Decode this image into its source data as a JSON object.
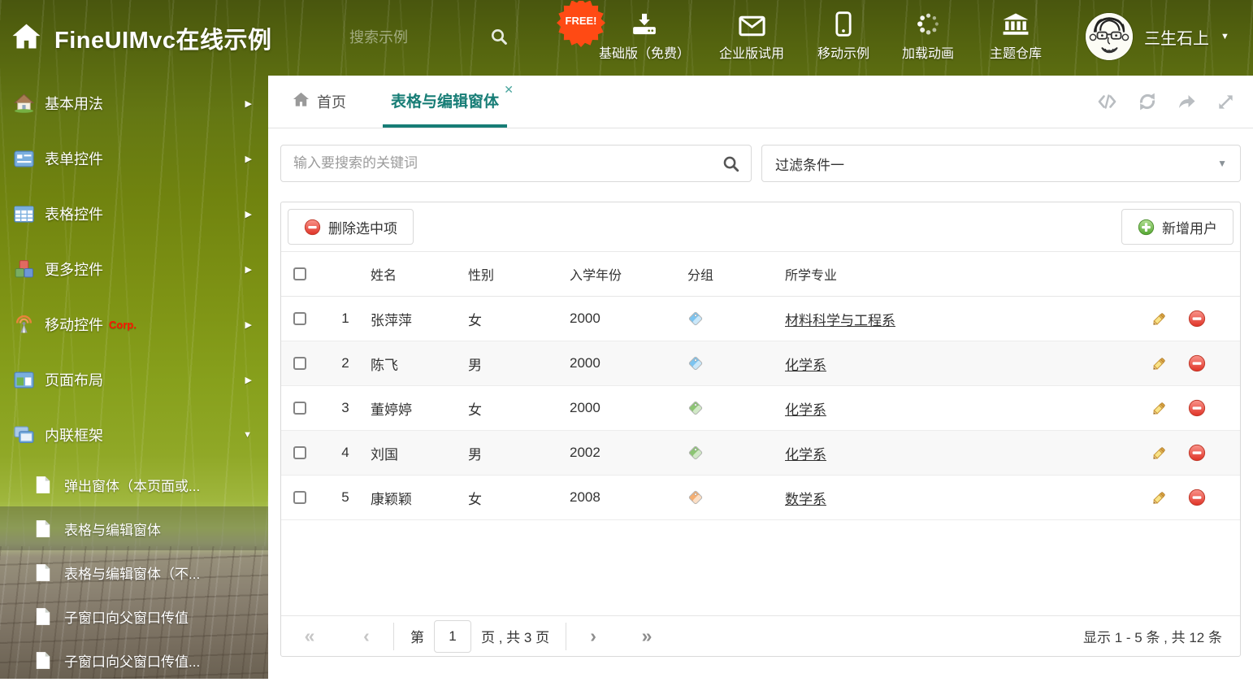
{
  "colors": {
    "accent_teal": "#177d76",
    "free_badge_bg": "#ff4a14",
    "corp_red": "#ff1400",
    "tag_blue": "#7cc4f0",
    "tag_green": "#8cc573",
    "tag_orange": "#f5af72"
  },
  "glyphs": {
    "caret_down": "▼",
    "arrow_right": "▶",
    "close": "✕",
    "pg_first": "«",
    "pg_prev": "‹",
    "pg_next": "›",
    "pg_last": "»"
  },
  "header": {
    "title": "FineUIMvc在线示例",
    "search_placeholder": "搜索示例",
    "free_badge": "FREE!",
    "nav": [
      {
        "label": "基础版（免费）",
        "icon": "download-icon"
      },
      {
        "label": "企业版试用",
        "icon": "envelope-icon"
      },
      {
        "label": "移动示例",
        "icon": "mobile-icon"
      },
      {
        "label": "加载动画",
        "icon": "spinner-icon"
      },
      {
        "label": "主题仓库",
        "icon": "bank-icon"
      }
    ],
    "user_name": "三生石上"
  },
  "sidebar": {
    "items": [
      {
        "label": "基本用法",
        "icon": "house-icon"
      },
      {
        "label": "表单控件",
        "icon": "form-icon"
      },
      {
        "label": "表格控件",
        "icon": "grid-icon"
      },
      {
        "label": "更多控件",
        "icon": "cubes-icon"
      },
      {
        "label": "移动控件",
        "badge": "Corp.",
        "icon": "antenna-icon"
      },
      {
        "label": "页面布局",
        "icon": "layout-icon"
      },
      {
        "label": "内联框架",
        "icon": "frames-icon"
      }
    ],
    "subitems": [
      {
        "label": "弹出窗体（本页面或..."
      },
      {
        "label": "表格与编辑窗体",
        "selected": true
      },
      {
        "label": "表格与编辑窗体（不..."
      },
      {
        "label": "子窗口向父窗口传值"
      },
      {
        "label": "子窗口向父窗口传值..."
      }
    ]
  },
  "tabs": {
    "home": "首页",
    "active": "表格与编辑窗体"
  },
  "filter_row": {
    "search_placeholder": "输入要搜索的关键词",
    "filter_value": "过滤条件一"
  },
  "toolbar": {
    "delete_label": "删除选中项",
    "add_label": "新增用户"
  },
  "table": {
    "columns": {
      "name": "姓名",
      "gender": "性别",
      "year": "入学年份",
      "group": "分组",
      "major": "所学专业"
    },
    "rows": [
      {
        "index": "1",
        "name": "张萍萍",
        "gender": "女",
        "year": "2000",
        "tag_color": "#7cc4f0",
        "major": "材料科学与工程系"
      },
      {
        "index": "2",
        "name": "陈飞",
        "gender": "男",
        "year": "2000",
        "tag_color": "#7cc4f0",
        "major": "化学系"
      },
      {
        "index": "3",
        "name": "董婷婷",
        "gender": "女",
        "year": "2000",
        "tag_color": "#8cc573",
        "major": "化学系"
      },
      {
        "index": "4",
        "name": "刘国",
        "gender": "男",
        "year": "2002",
        "tag_color": "#8cc573",
        "major": "化学系"
      },
      {
        "index": "5",
        "name": "康颖颖",
        "gender": "女",
        "year": "2008",
        "tag_color": "#f5af72",
        "major": "数学系"
      }
    ]
  },
  "pagination": {
    "page_prefix": "第",
    "page_value": "1",
    "page_suffix": "页 , 共 3 页",
    "summary": "显示 1 - 5 条 , 共 12 条"
  }
}
